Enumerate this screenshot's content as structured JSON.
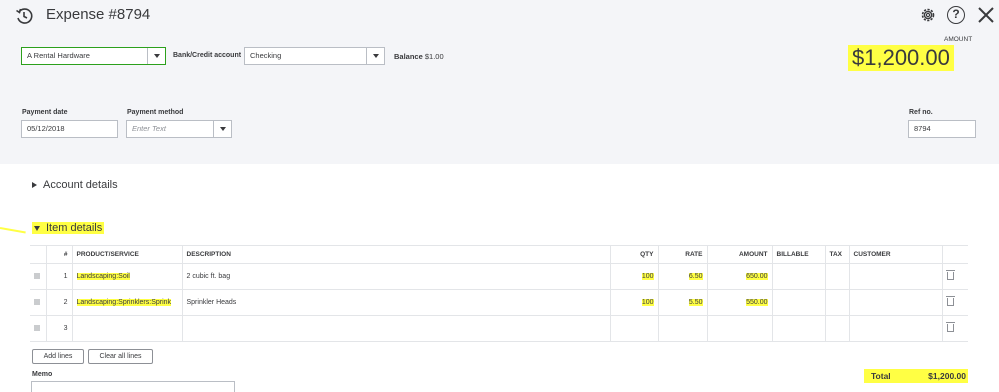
{
  "header": {
    "title": "Expense #8794",
    "amount_label": "AMOUNT",
    "amount_value": "$1,200.00"
  },
  "form": {
    "payee_value": "A Rental Hardware",
    "bank_label": "Bank/Credit account",
    "bank_value": "Checking",
    "balance_label": "Balance",
    "balance_value": "$1.00",
    "payment_date_label": "Payment date",
    "payment_date_value": "05/12/2018",
    "payment_method_label": "Payment method",
    "payment_method_placeholder": "Enter Text",
    "ref_label": "Ref no.",
    "ref_value": "8794"
  },
  "sections": {
    "account_details": "Account details",
    "item_details": "Item details"
  },
  "table": {
    "columns": [
      "#",
      "PRODUCT/SERVICE",
      "DESCRIPTION",
      "QTY",
      "RATE",
      "AMOUNT",
      "BILLABLE",
      "TAX",
      "CUSTOMER"
    ],
    "rows": [
      {
        "num": "1",
        "product": "Landscaping:Soil",
        "description": "2 cubic ft. bag",
        "qty": "100",
        "rate": "6.50",
        "amount": "650.00"
      },
      {
        "num": "2",
        "product": "Landscaping:Sprinklers:Sprink",
        "description": "Sprinkler Heads",
        "qty": "100",
        "rate": "5.50",
        "amount": "550.00"
      },
      {
        "num": "3",
        "product": "",
        "description": "",
        "qty": "",
        "rate": "",
        "amount": ""
      }
    ]
  },
  "buttons": {
    "add_lines": "Add lines",
    "clear_all_lines": "Clear all lines"
  },
  "memo_label": "Memo",
  "total": {
    "label": "Total",
    "value": "$1,200.00"
  },
  "icons": [
    "history-icon",
    "gear-icon",
    "help-icon",
    "close-icon",
    "drag-handle-icon",
    "trash-icon"
  ],
  "colors": {
    "highlight": "#ffff44",
    "focus_border": "#2ca01c",
    "header_bg": "#f4f5f8"
  }
}
